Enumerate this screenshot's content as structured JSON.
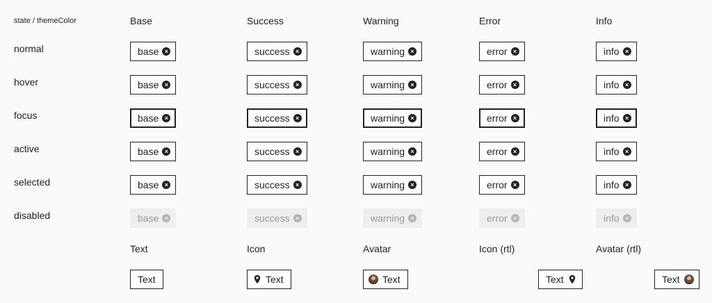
{
  "corner_label": "state / themeColor",
  "columns": [
    "Base",
    "Success",
    "Warning",
    "Error",
    "Info"
  ],
  "chip_labels": [
    "base",
    "success",
    "warning",
    "error",
    "info"
  ],
  "states": [
    "normal",
    "hover",
    "focus",
    "active",
    "selected",
    "disabled"
  ],
  "bottom_headers": [
    "Text",
    "Icon",
    "Avatar",
    "Icon (rtl)",
    "Avatar (rtl)"
  ],
  "bottom_chip_text": "Text",
  "close_glyph": "×",
  "icons": {
    "close": "close-circle-icon",
    "pin": "map-pin-icon",
    "avatar": "user-avatar-icon"
  }
}
